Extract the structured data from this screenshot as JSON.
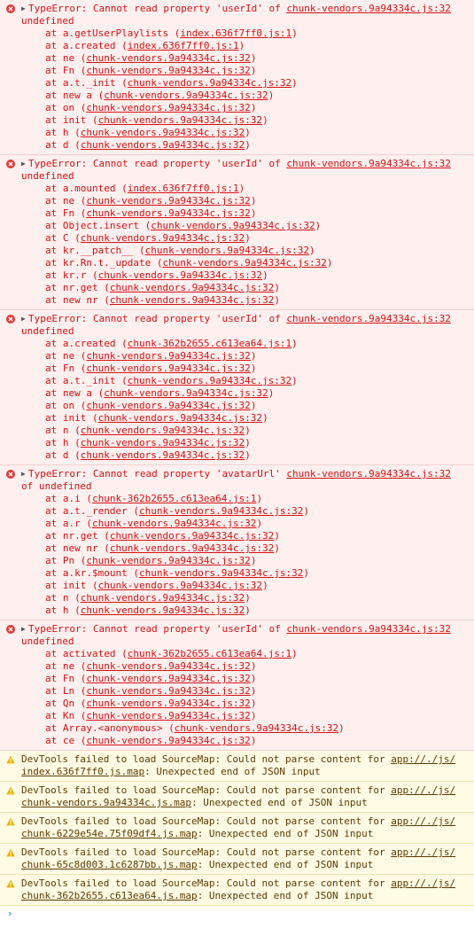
{
  "errors": [
    {
      "message": "TypeError: Cannot read property 'userId' of ",
      "source": "chunk-vendors.9a94334c.js:32",
      "tail": "undefined",
      "frames": [
        {
          "fn": "a.getUserPlaylists",
          "loc": "index.636f7ff0.js:1"
        },
        {
          "fn": "a.created",
          "loc": "index.636f7ff0.js:1"
        },
        {
          "fn": "ne",
          "loc": "chunk-vendors.9a94334c.js:32"
        },
        {
          "fn": "Fn",
          "loc": "chunk-vendors.9a94334c.js:32"
        },
        {
          "fn": "a.t._init",
          "loc": "chunk-vendors.9a94334c.js:32"
        },
        {
          "fn": "new a",
          "loc": "chunk-vendors.9a94334c.js:32"
        },
        {
          "fn": "on",
          "loc": "chunk-vendors.9a94334c.js:32"
        },
        {
          "fn": "init",
          "loc": "chunk-vendors.9a94334c.js:32"
        },
        {
          "fn": "h",
          "loc": "chunk-vendors.9a94334c.js:32"
        },
        {
          "fn": "d",
          "loc": "chunk-vendors.9a94334c.js:32"
        }
      ]
    },
    {
      "message": "TypeError: Cannot read property 'userId' of ",
      "source": "chunk-vendors.9a94334c.js:32",
      "tail": "undefined",
      "frames": [
        {
          "fn": "a.mounted",
          "loc": "index.636f7ff0.js:1"
        },
        {
          "fn": "ne",
          "loc": "chunk-vendors.9a94334c.js:32"
        },
        {
          "fn": "Fn",
          "loc": "chunk-vendors.9a94334c.js:32"
        },
        {
          "fn": "Object.insert",
          "loc": "chunk-vendors.9a94334c.js:32"
        },
        {
          "fn": "C",
          "loc": "chunk-vendors.9a94334c.js:32"
        },
        {
          "fn": "kr.__patch__",
          "loc": "chunk-vendors.9a94334c.js:32"
        },
        {
          "fn": "kr.Rn.t._update",
          "loc": "chunk-vendors.9a94334c.js:32"
        },
        {
          "fn": "kr.r",
          "loc": "chunk-vendors.9a94334c.js:32"
        },
        {
          "fn": "nr.get",
          "loc": "chunk-vendors.9a94334c.js:32"
        },
        {
          "fn": "new nr",
          "loc": "chunk-vendors.9a94334c.js:32"
        }
      ]
    },
    {
      "message": "TypeError: Cannot read property 'userId' of ",
      "source": "chunk-vendors.9a94334c.js:32",
      "tail": "undefined",
      "frames": [
        {
          "fn": "a.created",
          "loc": "chunk-362b2655.c613ea64.js:1"
        },
        {
          "fn": "ne",
          "loc": "chunk-vendors.9a94334c.js:32"
        },
        {
          "fn": "Fn",
          "loc": "chunk-vendors.9a94334c.js:32"
        },
        {
          "fn": "a.t._init",
          "loc": "chunk-vendors.9a94334c.js:32"
        },
        {
          "fn": "new a",
          "loc": "chunk-vendors.9a94334c.js:32"
        },
        {
          "fn": "on",
          "loc": "chunk-vendors.9a94334c.js:32"
        },
        {
          "fn": "init",
          "loc": "chunk-vendors.9a94334c.js:32"
        },
        {
          "fn": "n",
          "loc": "chunk-vendors.9a94334c.js:32"
        },
        {
          "fn": "h",
          "loc": "chunk-vendors.9a94334c.js:32"
        },
        {
          "fn": "d",
          "loc": "chunk-vendors.9a94334c.js:32"
        }
      ]
    },
    {
      "message": "TypeError: Cannot read property 'avatarUrl' ",
      "source": "chunk-vendors.9a94334c.js:32",
      "tail": "of undefined",
      "frames": [
        {
          "fn": "a.i",
          "loc": "chunk-362b2655.c613ea64.js:1"
        },
        {
          "fn": "a.t._render",
          "loc": "chunk-vendors.9a94334c.js:32"
        },
        {
          "fn": "a.r",
          "loc": "chunk-vendors.9a94334c.js:32"
        },
        {
          "fn": "nr.get",
          "loc": "chunk-vendors.9a94334c.js:32"
        },
        {
          "fn": "new nr",
          "loc": "chunk-vendors.9a94334c.js:32"
        },
        {
          "fn": "Pn",
          "loc": "chunk-vendors.9a94334c.js:32"
        },
        {
          "fn": "a.kr.$mount",
          "loc": "chunk-vendors.9a94334c.js:32"
        },
        {
          "fn": "init",
          "loc": "chunk-vendors.9a94334c.js:32"
        },
        {
          "fn": "n",
          "loc": "chunk-vendors.9a94334c.js:32"
        },
        {
          "fn": "h",
          "loc": "chunk-vendors.9a94334c.js:32"
        }
      ]
    },
    {
      "message": "TypeError: Cannot read property 'userId' of ",
      "source": "chunk-vendors.9a94334c.js:32",
      "tail": "undefined",
      "frames": [
        {
          "fn": "activated",
          "loc": "chunk-362b2655.c613ea64.js:1"
        },
        {
          "fn": "ne",
          "loc": "chunk-vendors.9a94334c.js:32"
        },
        {
          "fn": "Fn",
          "loc": "chunk-vendors.9a94334c.js:32"
        },
        {
          "fn": "Ln",
          "loc": "chunk-vendors.9a94334c.js:32"
        },
        {
          "fn": "Qn",
          "loc": "chunk-vendors.9a94334c.js:32"
        },
        {
          "fn": "Kn",
          "loc": "chunk-vendors.9a94334c.js:32"
        },
        {
          "fn": "Array.<anonymous>",
          "loc": "chunk-vendors.9a94334c.js:32"
        },
        {
          "fn": "ce",
          "loc": "chunk-vendors.9a94334c.js:32"
        }
      ]
    }
  ],
  "warnings": [
    {
      "prefix": "DevTools failed to load SourceMap: Could not parse content for ",
      "link_a": "app://./js/",
      "link_b": "index.636f7ff0.js.map",
      "suffix": ": Unexpected end of JSON input"
    },
    {
      "prefix": "DevTools failed to load SourceMap: Could not parse content for ",
      "link_a": "app://./js/",
      "link_b": "chunk-vendors.9a94334c.js.map",
      "suffix": ": Unexpected end of JSON input"
    },
    {
      "prefix": "DevTools failed to load SourceMap: Could not parse content for ",
      "link_a": "app://./js/",
      "link_b": "chunk-6229e54e.75f09df4.js.map",
      "suffix": ": Unexpected end of JSON input"
    },
    {
      "prefix": "DevTools failed to load SourceMap: Could not parse content for ",
      "link_a": "app://./js/",
      "link_b": "chunk-65c8d003.1c6287bb.js.map",
      "suffix": ": Unexpected end of JSON input"
    },
    {
      "prefix": "DevTools failed to load SourceMap: Could not parse content for ",
      "link_a": "app://./js/",
      "link_b": "chunk-362b2655.c613ea64.js.map",
      "suffix": ": Unexpected end of JSON input"
    }
  ],
  "strings": {
    "at": "at ",
    "open": "(",
    "close": ")",
    "expand": "▶",
    "prompt": "›"
  },
  "icons": {
    "error": "error-circle-icon",
    "warning": "warning-triangle-icon",
    "prompt": "console-prompt-icon"
  },
  "colors": {
    "error_text": "#d81111",
    "error_bg": "#fff0f0",
    "warning_text": "#5c3b00",
    "warning_bg": "#fffbe5",
    "warning_icon": "#e8b400",
    "prompt": "#1a73e8"
  }
}
